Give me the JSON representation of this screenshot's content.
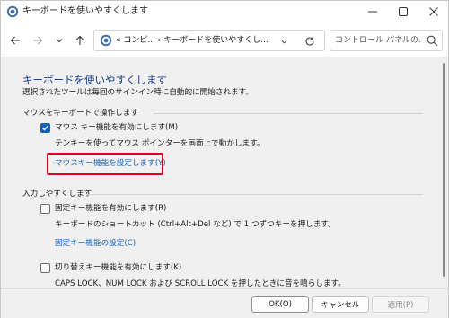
{
  "window": {
    "title": "キーボードを使いやすくします",
    "controls": [
      "minimize-icon",
      "maximize-icon",
      "close-icon"
    ]
  },
  "navbar": {
    "breadcrumb": "« コンピ...  ›  キーボードを使いやすくし...",
    "search_placeholder": "コントロール パネルの..."
  },
  "content": {
    "title": "キーボードを使いやすくします",
    "description": "選択されたツールは毎回のサインイン時に自動的に開始されます。",
    "sections": {
      "mouse": {
        "header": "マウスをキーボードで操作します",
        "checkbox_label": "マウス キー機能を有効にします(M)",
        "checkbox_checked": true,
        "note": "テンキーを使ってマウス ポインターを画面上で動かします。",
        "link": "マウスキー機能を設定します(Y)"
      },
      "input": {
        "header": "入力しやすくします",
        "sticky_checkbox_label": "固定キー機能を有効にします(R)",
        "sticky_checkbox_checked": false,
        "sticky_note": "キーボードのショートカット (Ctrl+Alt+Del など) で 1 つずつキーを押します。",
        "sticky_link": "固定キー機能の設定(C)",
        "toggle_checkbox_label": "切り替えキー機能を有効にします(K)",
        "toggle_checkbox_checked": false,
        "toggle_note": "CAPS LOCK、NUM LOCK および SCROLL LOCK を押したときに音を鳴らします。"
      }
    }
  },
  "footer": {
    "ok_label": "OK(O)",
    "cancel_label": "キャンセル",
    "apply_label": "適用(P)"
  },
  "colors": {
    "accent": "#0f63b8",
    "heading": "#1a3f8f",
    "link": "#1565c0",
    "highlight": "#e0001b"
  }
}
